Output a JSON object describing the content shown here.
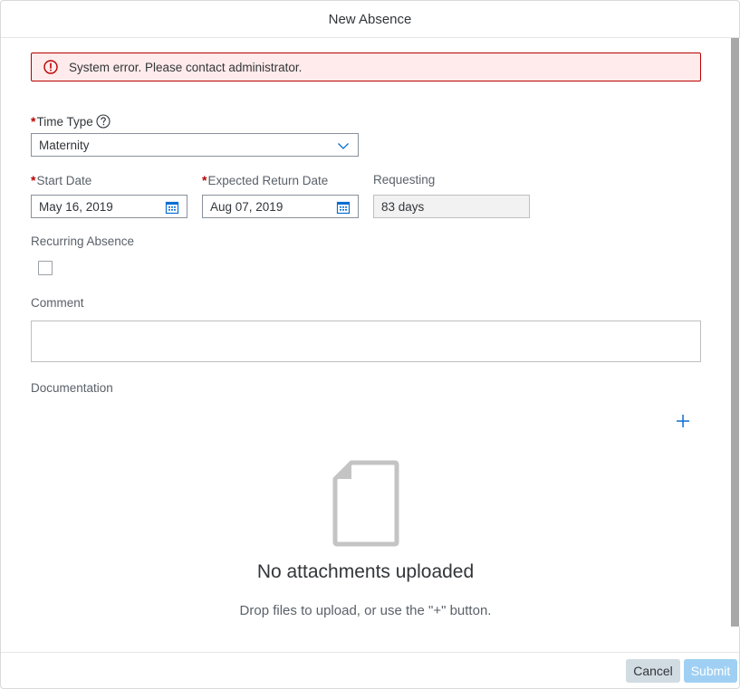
{
  "dialog": {
    "title": "New Absence"
  },
  "error": {
    "message": "System error. Please contact administrator."
  },
  "form": {
    "time_type": {
      "label": "Time Type",
      "required_mark": "*",
      "value": "Maternity"
    },
    "start_date": {
      "label": "Start Date",
      "required_mark": "*",
      "value": "May 16, 2019"
    },
    "return_date": {
      "label": "Expected Return Date",
      "required_mark": "*",
      "value": "Aug 07, 2019"
    },
    "requesting": {
      "label": "Requesting",
      "value": "83 days"
    },
    "recurring": {
      "label": "Recurring Absence",
      "checked": false
    },
    "comment": {
      "label": "Comment",
      "value": ""
    },
    "documentation": {
      "label": "Documentation",
      "empty_title": "No attachments uploaded",
      "empty_hint": "Drop files to upload, or use the \"+\" button."
    }
  },
  "footer": {
    "cancel_label": "Cancel",
    "submit_label": "Submit"
  },
  "colors": {
    "error_border": "#bb0000",
    "error_background": "#ffebeb",
    "accent": "#0a6ed1",
    "submit_disabled": "#9fd0f3",
    "cancel_background": "#d1dbe2"
  },
  "icons": {
    "error": "error-circle-icon",
    "help": "help-icon",
    "dropdown": "chevron-down-icon",
    "calendar": "calendar-icon",
    "add": "plus-icon",
    "empty": "document-icon"
  }
}
